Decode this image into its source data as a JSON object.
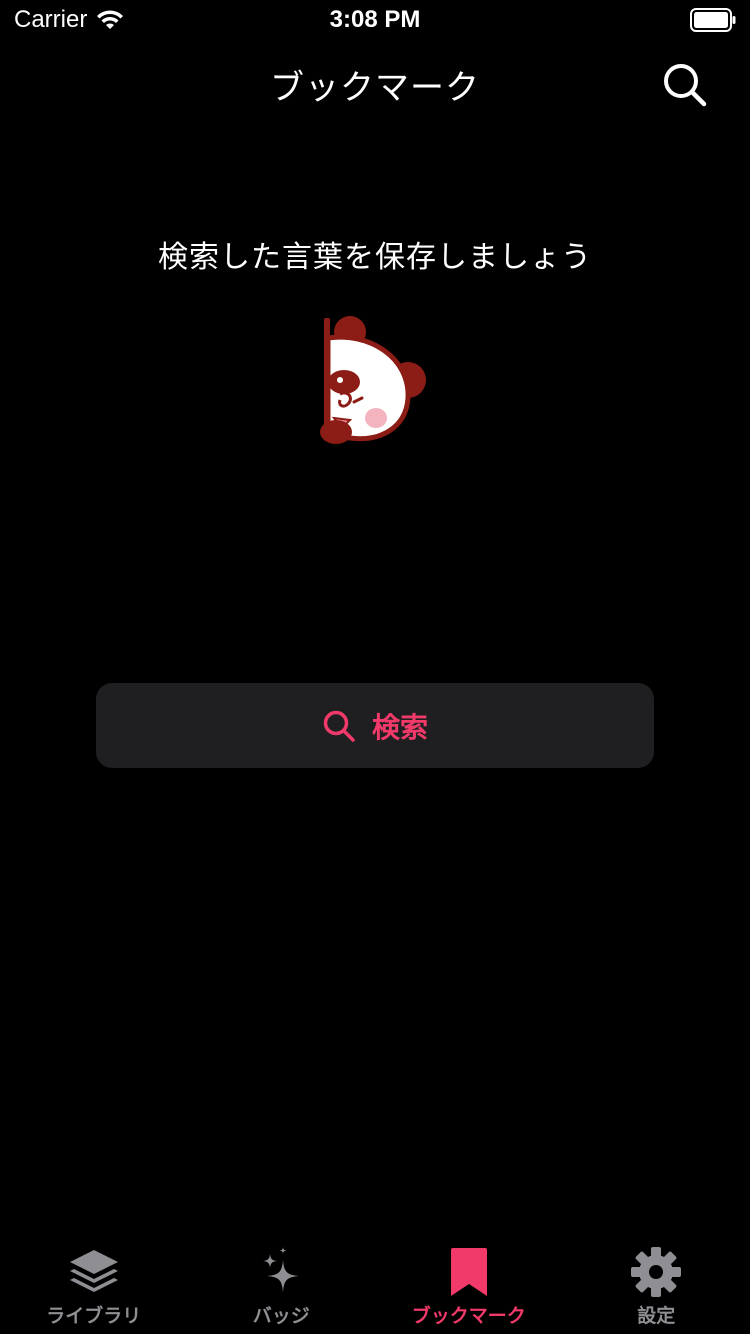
{
  "status_bar": {
    "carrier": "Carrier",
    "time": "3:08 PM",
    "wifi_icon": "wifi-icon",
    "battery_icon": "battery-icon"
  },
  "nav": {
    "title": "ブックマーク",
    "search_icon": "search-icon"
  },
  "empty_state": {
    "message": "検索した言葉を保存しましょう",
    "illustration": "panda-mascot"
  },
  "search_button": {
    "label": "検索",
    "icon": "search-icon"
  },
  "tab_bar": {
    "tabs": [
      {
        "label": "ライブラリ",
        "icon": "layers-icon",
        "active": false
      },
      {
        "label": "バッジ",
        "icon": "sparkles-icon",
        "active": false
      },
      {
        "label": "ブックマーク",
        "icon": "bookmark-icon",
        "active": true
      },
      {
        "label": "設定",
        "icon": "gear-icon",
        "active": false
      }
    ]
  },
  "colors": {
    "accent": "#f23a6a",
    "background": "#000000",
    "button_background": "#1f1f21",
    "inactive_tab": "#8e8e93"
  }
}
